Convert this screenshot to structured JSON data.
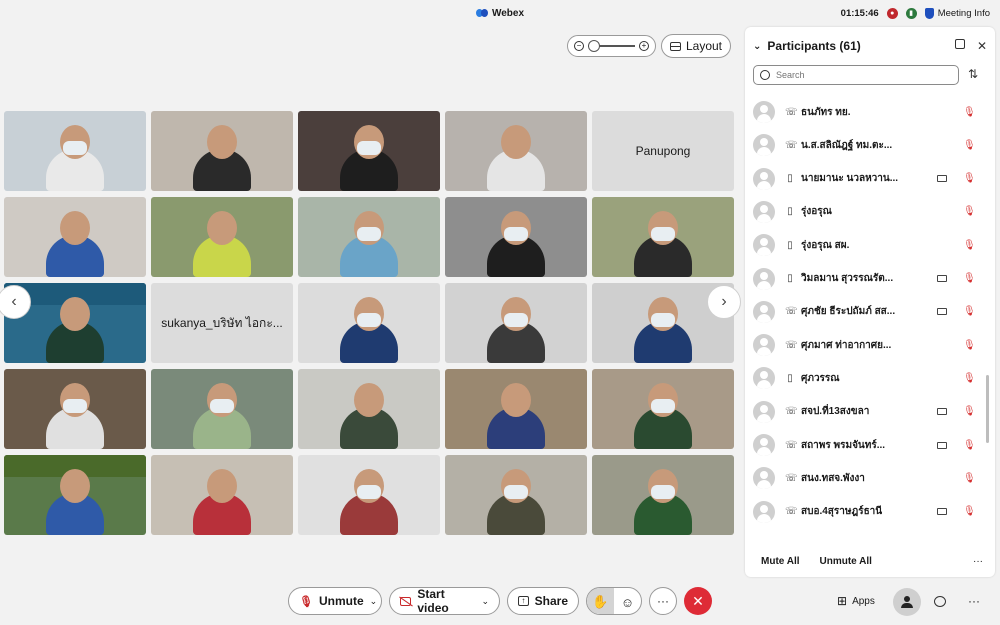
{
  "window": {
    "app_title": "Webex",
    "clock": "01:15:46",
    "meeting_info": "Meeting Info"
  },
  "top_controls": {
    "layout_label": "Layout"
  },
  "video_tiles": [
    {
      "type": "video",
      "bg": "#c8d0d6",
      "shirt": "#e9e9e9",
      "masked": true
    },
    {
      "type": "video",
      "bg": "#bfb7ad",
      "shirt": "#2a2a2a",
      "masked": false
    },
    {
      "type": "video",
      "bg": "#4b3f3c",
      "shirt": "#1e1e1e",
      "masked": true
    },
    {
      "type": "video",
      "bg": "#b7b2ad",
      "shirt": "#e5e5e5",
      "masked": false
    },
    {
      "type": "name",
      "name": "Panupong"
    },
    {
      "type": "video",
      "bg": "#cfcac4",
      "shirt": "#2f5aa8",
      "masked": false
    },
    {
      "type": "video",
      "bg": "#8a9a6e",
      "shirt": "#c9d64a",
      "masked": false
    },
    {
      "type": "video",
      "bg": "#a9b5a8",
      "shirt": "#6aa4c8",
      "masked": true
    },
    {
      "type": "video",
      "bg": "#8e8e8e",
      "shirt": "#1e1e1e",
      "masked": true
    },
    {
      "type": "video",
      "bg": "#9aa27c",
      "shirt": "#2a2a2a",
      "masked": true
    },
    {
      "type": "video",
      "bg": "#2a6a8a",
      "shirt": "#1e3e30",
      "masked": false,
      "banner": "#1d5a7a"
    },
    {
      "type": "name",
      "name": "sukanya_บริษัท ไอกะ..."
    },
    {
      "type": "video",
      "bg": "#dcdcdc",
      "shirt": "#1f3b70",
      "masked": true
    },
    {
      "type": "video",
      "bg": "#d2d2d2",
      "shirt": "#3a3a3a",
      "masked": true
    },
    {
      "type": "video",
      "bg": "#cfcfcf",
      "shirt": "#1f3b70",
      "masked": true
    },
    {
      "type": "video",
      "bg": "#6a5a4a",
      "shirt": "#e0e0e0",
      "masked": true
    },
    {
      "type": "video",
      "bg": "#7a8a7a",
      "shirt": "#9ab48a",
      "masked": true
    },
    {
      "type": "video",
      "bg": "#c9c9c4",
      "shirt": "#3a4a3a",
      "masked": false
    },
    {
      "type": "video",
      "bg": "#9a8870",
      "shirt": "#2c3e7a",
      "masked": false
    },
    {
      "type": "video",
      "bg": "#a89a88",
      "shirt": "#2a4a30",
      "masked": true
    },
    {
      "type": "video",
      "bg": "#5a7a4a",
      "shirt": "#2f5aa8",
      "masked": false,
      "banner": "#4a6a2a"
    },
    {
      "type": "video",
      "bg": "#c6bfb4",
      "shirt": "#b8303a",
      "masked": false
    },
    {
      "type": "video",
      "bg": "#e0e0e0",
      "shirt": "#9a3a3a",
      "masked": true
    },
    {
      "type": "video",
      "bg": "#b4b0a6",
      "shirt": "#4a4a3a",
      "masked": true
    },
    {
      "type": "video",
      "bg": "#9a9a8a",
      "shirt": "#2a5a30",
      "masked": true
    }
  ],
  "participants_panel": {
    "title": "Participants (61)",
    "search_placeholder": "Search",
    "participants": [
      {
        "name": "ธนภัทร ทย.",
        "device": "phone",
        "video": false
      },
      {
        "name": "น.ส.สลิณัฎฐ์ ทม.ตะ...",
        "device": "phone",
        "video": false
      },
      {
        "name": "นายมานะ นวลหวาน...",
        "device": "mobile",
        "video": true
      },
      {
        "name": "รุ่งอรุณ",
        "device": "mobile",
        "video": false
      },
      {
        "name": "รุ่งอรุณ สผ.",
        "device": "mobile",
        "video": false
      },
      {
        "name": "วิมลมาน สุวรรณรัต...",
        "device": "mobile",
        "video": true
      },
      {
        "name": "ศุภชัย ธีระปถัมภ์ สส...",
        "device": "phone",
        "video": true
      },
      {
        "name": "ศุภมาศ ท่าอากาศย...",
        "device": "phone",
        "video": false
      },
      {
        "name": "ศุภวรรณ",
        "device": "mobile",
        "video": false
      },
      {
        "name": "สจป.ที่13สงขลา",
        "device": "phone",
        "video": true
      },
      {
        "name": "สถาพร พรมจันทร์...",
        "device": "phone",
        "video": true
      },
      {
        "name": "สนง.ทสจ.พังงา",
        "device": "phone",
        "video": false
      },
      {
        "name": "สบอ.4สุราษฎร์ธานี",
        "device": "phone",
        "video": true
      }
    ],
    "mute_all": "Mute All",
    "unmute_all": "Unmute All"
  },
  "toolbar": {
    "unmute": "Unmute",
    "start_video": "Start video",
    "share": "Share",
    "apps": "Apps"
  },
  "colors": {
    "leave": "#de2b36",
    "muted": "#c9292b",
    "accent": "#1e4fbd"
  }
}
